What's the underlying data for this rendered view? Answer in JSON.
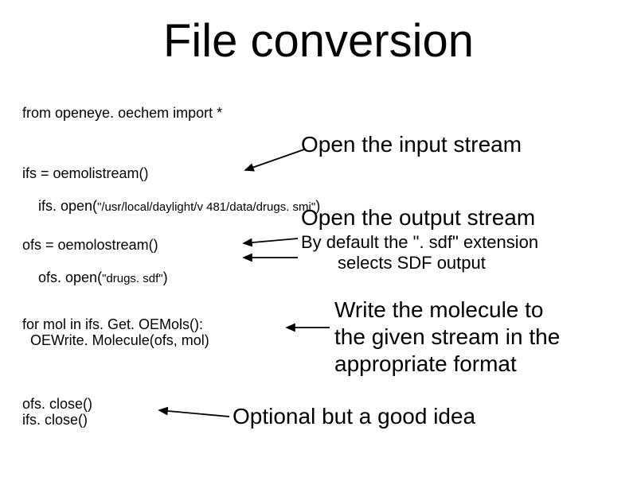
{
  "title": "File conversion",
  "code": {
    "import_line": "from openeye. oechem import *",
    "ifs_decl": "ifs = oemolistream()",
    "ifs_open_prefix": "ifs. open(",
    "ifs_open_arg": "\"/usr/local/daylight/v 481/data/drugs. smi\"",
    "ifs_open_suffix": ")",
    "ofs_decl": "ofs = oemolostream()",
    "ofs_open_prefix": "ofs. open(",
    "ofs_open_arg": "\"drugs. sdf\"",
    "ofs_open_suffix": ")",
    "loop_line1": "for mol in ifs. Get. OEMols():",
    "loop_line2": "  OEWrite. Molecule(ofs, mol)",
    "close1": "ofs. close()",
    "close2": "ifs. close()"
  },
  "annotations": {
    "open_input": "Open the input stream",
    "open_output": "Open the output stream",
    "sdf_note_line1": "By default the \". sdf\" extension",
    "sdf_note_line2": "selects SDF output",
    "write_line1": "Write the molecule to",
    "write_line2": "the given stream in the",
    "write_line3": "appropriate format",
    "optional": "Optional but a good idea"
  }
}
